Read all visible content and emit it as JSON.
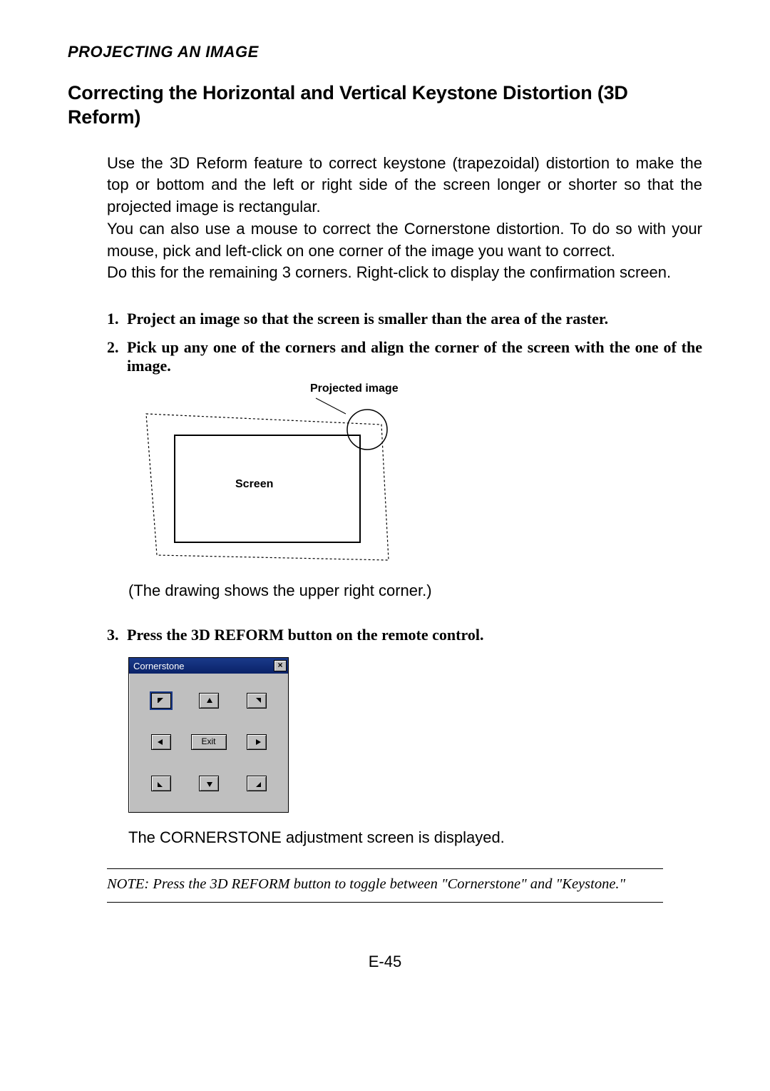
{
  "header": {
    "section": "PROJECTING AN IMAGE"
  },
  "title": "Correcting the Horizontal and Vertical Keystone Distortion (3D Reform)",
  "intro": {
    "p1": "Use the 3D Reform feature to correct keystone (trapezoidal) distortion to make the top or bottom and the left or right side of the screen longer or shorter so that the projected image is rectangular.",
    "p2": "You can also use a mouse to correct the Cornerstone distortion. To do so with your mouse, pick and left-click on one corner of the image you want to correct.",
    "p3": "Do this for the remaining 3 corners. Right-click to display the confirmation screen."
  },
  "steps": {
    "s1": "Project an image so that the screen is smaller than the area of the raster.",
    "s2": "Pick up any one of the corners and align the corner of the screen with the one of the image.",
    "s3": "Press the 3D REFORM button on the remote control."
  },
  "figure": {
    "projected_label": "Projected image",
    "screen_label": "Screen",
    "caption": "(The drawing shows the upper right corner.)"
  },
  "dialog": {
    "title": "Cornerstone",
    "exit": "Exit"
  },
  "after_dialog": "The CORNERSTONE adjustment screen is displayed.",
  "note": "NOTE: Press the 3D REFORM button to toggle between \"Cornerstone\" and \"Keystone.\"",
  "footer": "E-45"
}
